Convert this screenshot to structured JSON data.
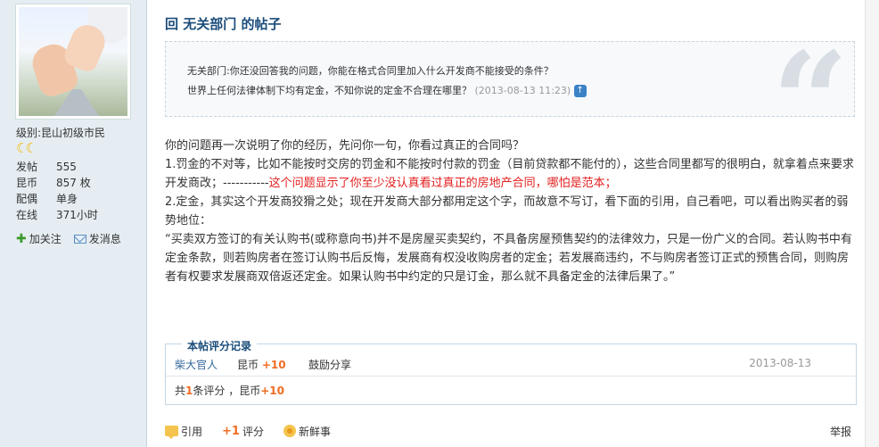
{
  "sidebar": {
    "level_label": "级别:",
    "level_value": "昆山初级市民",
    "moon_icons": "☾☾",
    "stats": [
      {
        "key": "发帖",
        "value": "555"
      },
      {
        "key": "昆币",
        "value": "857 枚"
      },
      {
        "key": "配偶",
        "value": "单身"
      },
      {
        "key": "在线",
        "value": "371小时"
      }
    ],
    "follow_label": "加关注",
    "message_label": "发消息"
  },
  "post": {
    "title": "回 无关部门 的帖子",
    "quote_line1": "无关部门:你还没回答我的问题，你能在格式合同里加入什么开发商不能接受的条件？",
    "quote_line2": "世界上任何法律体制下均有定金，不知你说的定金不合理在哪里？",
    "quote_meta": "(2013-08-13 11:23)",
    "quote_mark": "“",
    "para1": "你的问题再一次说明了你的经历，先问你一句，你看过真正的合同吗？",
    "para2_a": "1.罚金的不对等，比如不能按时交房的罚金和不能按时付款的罚金（目前贷款都不能付的），这些合同里都写的很明白，就拿着点来要求开发商改；-----------",
    "para2_red": "这个问题显示了你至少没认真看过真正的房地产合同，哪怕是范本；",
    "para3": "2.定金，其实这个开发商狡猾之处；现在开发商大部分都用定这个字，而故意不写订，看下面的引用，自己看吧，可以看出购买者的弱势地位：",
    "para4": "“买卖双方签订的有关认购书(或称意向书)并不是房屋买卖契约，不具备房屋预售契约的法律效力，只是一份广义的合同。若认购书中有定金条款，则若购房者在签订认购书后反悔，发展商有权没收购房者的定金；若发展商违约，不与购房者签订正式的预售合同，则购房者有权要求发展商双倍返还定金。如果认购书中约定的只是订金，那么就不具备定金的法律后果了。”"
  },
  "rating": {
    "title": "本帖评分记录",
    "user": "柴大官人",
    "unit": "昆币",
    "points": "+10",
    "reason": "鼓励分享",
    "date": "2013-08-13",
    "total_prefix": "共",
    "total_count": "1",
    "total_mid": "条评分 ，昆币",
    "total_points": "+10"
  },
  "actions": {
    "quote_label": "引用",
    "rate_label": "评分",
    "fresh_label": "新鲜事",
    "report_label": "举报"
  }
}
